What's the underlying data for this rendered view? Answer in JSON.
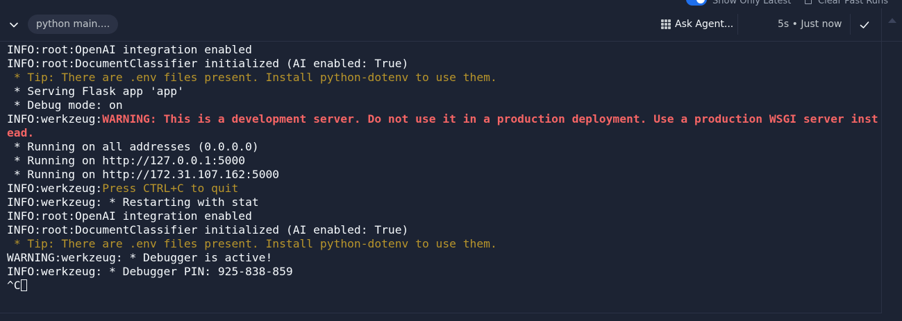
{
  "topbar": {
    "show_latest_label": "Show Only Latest",
    "clear_runs_label": "Clear Past Runs"
  },
  "header": {
    "run_pill": "python main....",
    "ask_agent_label": "Ask Agent...",
    "duration": "5s",
    "separator": "•",
    "timestamp": "Just now"
  },
  "colors": {
    "background": "#1c2333",
    "text": "#f5f9fc",
    "tip": "#b8952b",
    "warning": "#f56565",
    "accent": "#1f6feb"
  },
  "console": {
    "lines": [
      [
        {
          "text": "INFO:root:OpenAI integration enabled",
          "style": "default"
        }
      ],
      [
        {
          "text": "INFO:root:DocumentClassifier initialized (AI enabled: True)",
          "style": "default"
        }
      ],
      [
        {
          "text": " * Tip: There are .env files present. Install python-dotenv to use them.",
          "style": "tip"
        }
      ],
      [
        {
          "text": " * Serving Flask app 'app'",
          "style": "default"
        }
      ],
      [
        {
          "text": " * Debug mode: on",
          "style": "default"
        }
      ],
      [
        {
          "text": "INFO:werkzeug:",
          "style": "default"
        },
        {
          "text": "WARNING: This is a development server. Do not use it in a production deployment. Use a production WSGI server instead.",
          "style": "warn"
        }
      ],
      [
        {
          "text": " * Running on all addresses (0.0.0.0)",
          "style": "default"
        }
      ],
      [
        {
          "text": " * Running on http://127.0.0.1:5000",
          "style": "default"
        }
      ],
      [
        {
          "text": " * Running on http://172.31.107.162:5000",
          "style": "default"
        }
      ],
      [
        {
          "text": "INFO:werkzeug:",
          "style": "default"
        },
        {
          "text": "Press CTRL+C to quit",
          "style": "quit"
        }
      ],
      [
        {
          "text": "INFO:werkzeug: * Restarting with stat",
          "style": "default"
        }
      ],
      [
        {
          "text": "INFO:root:OpenAI integration enabled",
          "style": "default"
        }
      ],
      [
        {
          "text": "INFO:root:DocumentClassifier initialized (AI enabled: True)",
          "style": "default"
        }
      ],
      [
        {
          "text": " * Tip: There are .env files present. Install python-dotenv to use them.",
          "style": "tip"
        }
      ],
      [
        {
          "text": "WARNING:werkzeug: * Debugger is active!",
          "style": "default"
        }
      ],
      [
        {
          "text": "INFO:werkzeug: * Debugger PIN: 925-838-859",
          "style": "default"
        }
      ],
      [
        {
          "text": "^C",
          "style": "default"
        }
      ]
    ]
  }
}
